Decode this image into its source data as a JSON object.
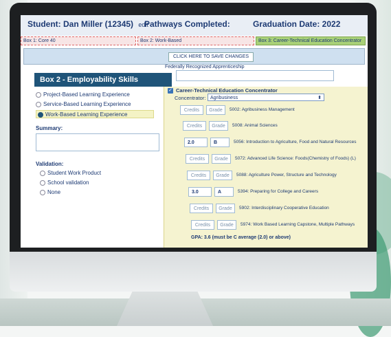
{
  "header": {
    "student": "Student: Dan Miller (12345)",
    "edit": "edit",
    "pathways": "Pathways Completed:",
    "graduation": "Graduation Date: 2022"
  },
  "tabs": [
    "Box 1: Core 40",
    "Box 2: Work-Based",
    "Box 3: Career-Technical Education Concentrator"
  ],
  "save_button": "CLICK HERE TO SAVE CHANGES",
  "left": {
    "title": "Box 2 - Employability Skills",
    "options": [
      "Project-Based Learning Experience",
      "Service-Based Learning Experience",
      "Work-Based Learning Experience"
    ],
    "selected_option": 2,
    "summary_label": "Summary:",
    "validation_label": "Validation:",
    "validation_options": [
      "Student Work Product",
      "School validation",
      "None"
    ]
  },
  "right": {
    "federal_text": "Federally Recognized Apprenticeship",
    "cte_title": "Career-Technical Education Concentrator",
    "concentrator_label": "Concentrator:",
    "concentrator_value": "Agribusiness",
    "credits_placeholder": "Credits",
    "grade_placeholder": "Grade",
    "courses": [
      {
        "credits": "",
        "grade": "",
        "name": "5002: Agribusiness Management"
      },
      {
        "credits": "",
        "grade": "",
        "name": "5008: Animal Sciences"
      },
      {
        "credits": "2.0",
        "grade": "B",
        "name": "5056: Introduction to Agriculture, Food and Natural Resources"
      },
      {
        "credits": "",
        "grade": "",
        "name": "5072: Advanced Life Science: Foods(Chemistry of Foods) (L)"
      },
      {
        "credits": "",
        "grade": "",
        "name": "5088: Agriculture Power, Structure and Technology"
      },
      {
        "credits": "3.0",
        "grade": "A",
        "name": "5394: Preparing for College and Careers"
      },
      {
        "credits": "",
        "grade": "",
        "name": "5902: Interdisciplinary Cooperative Education"
      },
      {
        "credits": "",
        "grade": "",
        "name": "5974: Work Based Learning Capstone, Multiple Pathways"
      }
    ],
    "gpa": "GPA: 3.6 (must be C average (2.0) or above)"
  }
}
